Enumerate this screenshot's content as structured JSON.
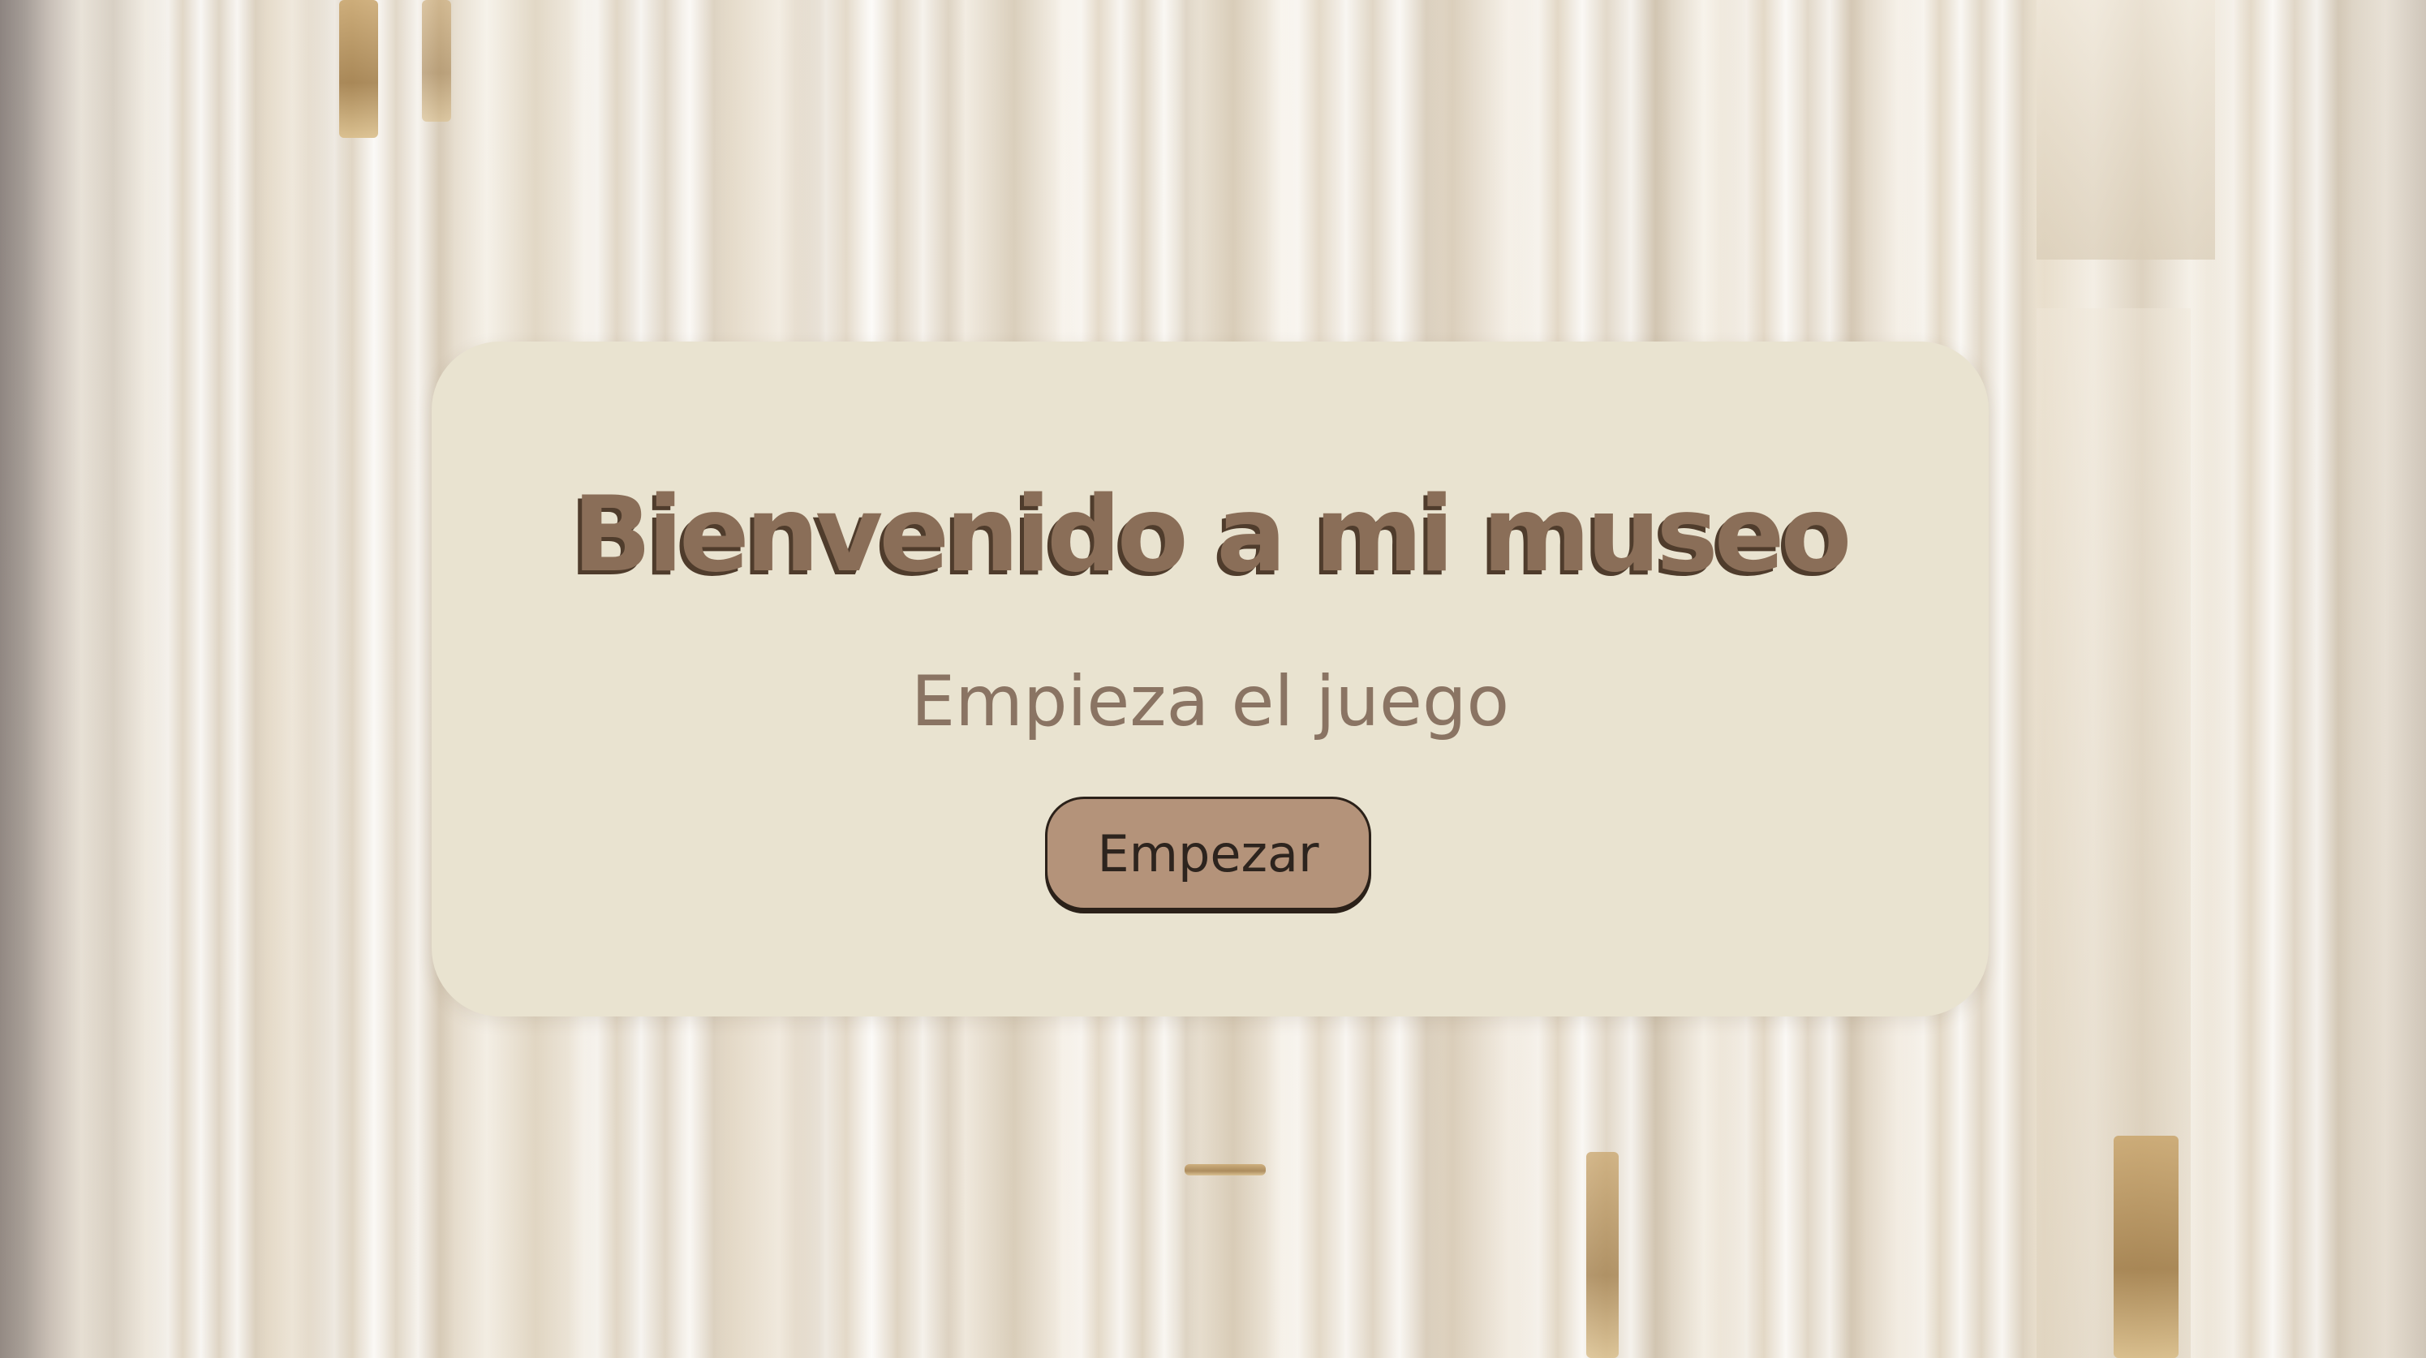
{
  "welcome": {
    "title": "Bienvenido a mi museo",
    "subtitle": "Empieza el juego",
    "start_button_label": "Empezar"
  },
  "colors": {
    "card_background": "#e9e3d0",
    "title_color": "#8a6e58",
    "title_shadow": "#4f3c2c",
    "subtitle_color": "#8a7463",
    "button_background": "#b4937a",
    "button_border": "#2b2119"
  }
}
